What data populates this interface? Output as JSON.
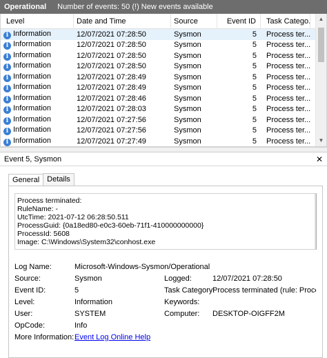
{
  "topbar": {
    "log_name": "Operational",
    "summary": "Number of events: 50 (!) New events available"
  },
  "grid": {
    "headers": {
      "level": "Level",
      "date": "Date and Time",
      "source": "Source",
      "event_id": "Event ID",
      "task": "Task Catego..."
    },
    "rows": [
      {
        "level": "Information",
        "date": "12/07/2021 07:28:50",
        "source": "Sysmon",
        "event_id": "5",
        "task": "Process ter..."
      },
      {
        "level": "Information",
        "date": "12/07/2021 07:28:50",
        "source": "Sysmon",
        "event_id": "5",
        "task": "Process ter..."
      },
      {
        "level": "Information",
        "date": "12/07/2021 07:28:50",
        "source": "Sysmon",
        "event_id": "5",
        "task": "Process ter..."
      },
      {
        "level": "Information",
        "date": "12/07/2021 07:28:50",
        "source": "Sysmon",
        "event_id": "5",
        "task": "Process ter..."
      },
      {
        "level": "Information",
        "date": "12/07/2021 07:28:49",
        "source": "Sysmon",
        "event_id": "5",
        "task": "Process ter..."
      },
      {
        "level": "Information",
        "date": "12/07/2021 07:28:49",
        "source": "Sysmon",
        "event_id": "5",
        "task": "Process ter..."
      },
      {
        "level": "Information",
        "date": "12/07/2021 07:28:46",
        "source": "Sysmon",
        "event_id": "5",
        "task": "Process ter..."
      },
      {
        "level": "Information",
        "date": "12/07/2021 07:28:03",
        "source": "Sysmon",
        "event_id": "5",
        "task": "Process ter..."
      },
      {
        "level": "Information",
        "date": "12/07/2021 07:27:56",
        "source": "Sysmon",
        "event_id": "5",
        "task": "Process ter..."
      },
      {
        "level": "Information",
        "date": "12/07/2021 07:27:56",
        "source": "Sysmon",
        "event_id": "5",
        "task": "Process ter..."
      },
      {
        "level": "Information",
        "date": "12/07/2021 07:27:49",
        "source": "Sysmon",
        "event_id": "5",
        "task": "Process ter..."
      }
    ]
  },
  "detail": {
    "title": "Event 5, Sysmon",
    "tabs": [
      "General",
      "Details"
    ],
    "message_lines": [
      "Process terminated:",
      "RuleName: -",
      "UtcTime: 2021-07-12 06:28:50.511",
      "ProcessGuid: {0a18ed80-e0c3-60eb-71f1-410000000000}",
      "ProcessId: 5608",
      "Image: C:\\Windows\\System32\\conhost.exe"
    ],
    "fields": {
      "log_name_label": "Log Name:",
      "log_name": "Microsoft-Windows-Sysmon/Operational",
      "source_label": "Source:",
      "source": "Sysmon",
      "logged_label": "Logged:",
      "logged": "12/07/2021 07:28:50",
      "event_id_label": "Event ID:",
      "event_id": "5",
      "task_label": "Task Category:",
      "task": "Process terminated (rule: ProcessT",
      "level_label": "Level:",
      "level": "Information",
      "keywords_label": "Keywords:",
      "keywords": "",
      "user_label": "User:",
      "user": "SYSTEM",
      "computer_label": "Computer:",
      "computer": "DESKTOP-OIGFF2M",
      "opcode_label": "OpCode:",
      "opcode": "Info",
      "more_info_label": "More Information:",
      "more_info_link": "Event Log Online Help"
    }
  }
}
